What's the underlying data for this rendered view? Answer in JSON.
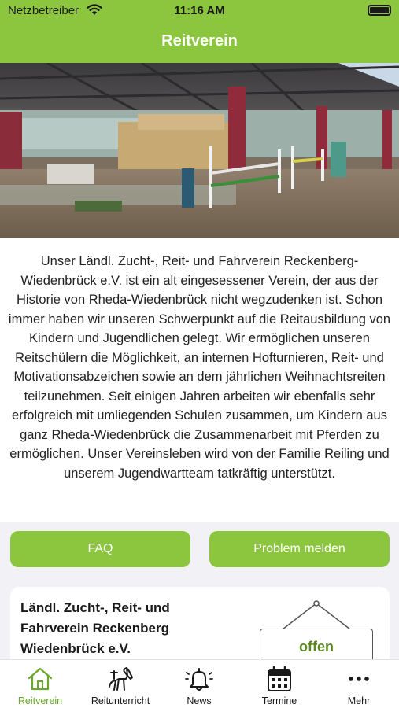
{
  "status_bar": {
    "carrier": "Netzbetreiber",
    "time": "11:16 AM",
    "wifi_icon": "wifi-icon",
    "battery_icon": "battery-icon"
  },
  "nav": {
    "title": "Reitverein"
  },
  "hero": {
    "image": "arena-photo"
  },
  "about": {
    "text": "Unser Ländl. Zucht-, Reit- und Fahrverein Reckenberg-Wiedenbrück e.V. ist ein alt eingesessener Verein, der aus der Historie von Rheda-Wiedenbrück nicht wegzudenken ist. Schon immer haben wir unseren Schwerpunkt auf die Reitausbildung von Kindern und Jugendlichen gelegt. Wir ermöglichen unseren Reitschülern die Möglichkeit, an internen Hofturnieren, Reit- und Motivationsabzeichen sowie an dem jährlichen Weihnachtsreiten teilzunehmen. Seit einigen Jahren arbeiten wir ebenfalls sehr erfolgreich mit umliegenden Schulen zusammen, um Kindern aus ganz Rheda-Wiedenbrück die Zusammenarbeit mit Pferden zu ermöglichen. Unser Vereinsleben wird von der Familie Reiling und unserem Jugendwartteam tatkräftig unterstützt."
  },
  "buttons": {
    "faq": "FAQ",
    "problem": "Problem melden"
  },
  "club": {
    "name": "Ländl. Zucht-, Reit- und Fahrverein Reckenberg Wiedenbrück e.V.",
    "status": "offen"
  },
  "tabs": [
    {
      "label": "Reitverein",
      "icon": "home-icon",
      "active": true
    },
    {
      "label": "Reitunterricht",
      "icon": "horse-icon",
      "active": false
    },
    {
      "label": "News",
      "icon": "bell-icon",
      "active": false
    },
    {
      "label": "Termine",
      "icon": "calendar-icon",
      "active": false
    },
    {
      "label": "Mehr",
      "icon": "more-icon",
      "active": false
    }
  ],
  "colors": {
    "accent": "#8cc63f",
    "active_tab": "#6aa82b",
    "status_open": "#5a8a1f"
  }
}
